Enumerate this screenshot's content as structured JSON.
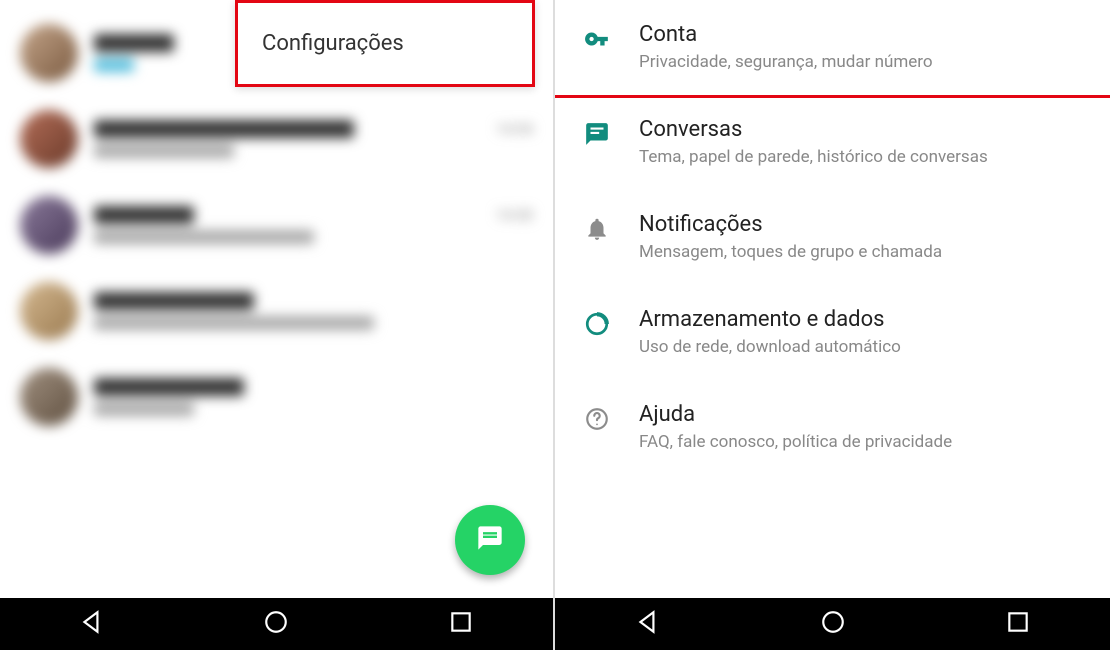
{
  "left": {
    "menu": {
      "label": "Configurações"
    },
    "chats": [
      {
        "time": ""
      },
      {
        "time": "14:54"
      },
      {
        "time": "14:30"
      },
      {
        "time": ""
      },
      {
        "time": ""
      }
    ]
  },
  "right": {
    "items": [
      {
        "title": "Conta",
        "desc": "Privacidade, segurança, mudar número",
        "icon": "key-icon",
        "highlighted": true
      },
      {
        "title": "Conversas",
        "desc": "Tema, papel de parede, histórico de conversas",
        "icon": "chat-icon"
      },
      {
        "title": "Notificações",
        "desc": "Mensagem, toques de grupo e chamada",
        "icon": "bell-icon"
      },
      {
        "title": "Armazenamento e dados",
        "desc": "Uso de rede, download automático",
        "icon": "data-icon"
      },
      {
        "title": "Ajuda",
        "desc": "FAQ, fale conosco, política de privacidade",
        "icon": "help-icon"
      }
    ]
  }
}
